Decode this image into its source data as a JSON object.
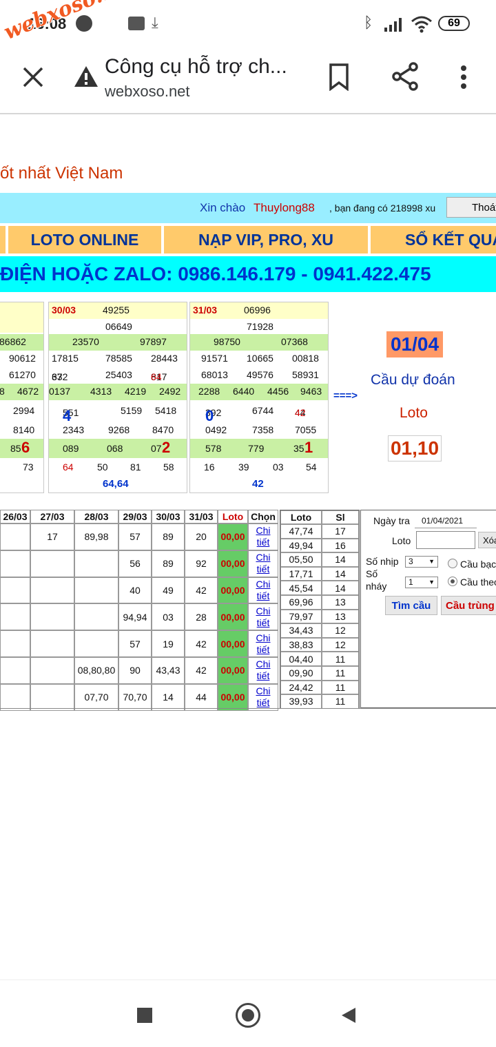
{
  "status": {
    "time": "16:08",
    "battery": "69"
  },
  "watermark": "webxoso.net",
  "browser": {
    "title": "Công cụ hỗ trợ ch...",
    "url": "webxoso.net"
  },
  "site": {
    "tagline": "ốt nhất Việt Nam",
    "greet_prefix": "Xin chào ",
    "username": "Thuylong88",
    "balance_text": ", bạn đang có 218998 xu",
    "logout_label": "Thoát",
    "menu": [
      "LOTO ONLINE",
      "NẠP VIP, PRO, XU",
      "SỔ KẾT QUẢ"
    ],
    "hotline": "ĐIỆN HOẶC ZALO: 0986.146.179 - 0941.422.475"
  },
  "results": {
    "b0": {
      "r1": "",
      "r2": "",
      "r3": "86862",
      "r4a": "90612",
      "r5": "61270",
      "r6a": "8",
      "r6b": "4672",
      "r7": "2994",
      "r8": "8140",
      "r9pre": "85",
      "r9big": "6",
      "r10": "73"
    },
    "b1": {
      "date": "30/03",
      "db": "49255",
      "g1": "06649",
      "g2a": "23570",
      "g2b": "97897",
      "g3": [
        "17815",
        "78585",
        "28443"
      ],
      "g3b": [
        "632",
        "37",
        "25403",
        "817",
        "64"
      ],
      "g4": [
        "0137",
        "4313",
        "4219",
        "2492"
      ],
      "g5a": "551",
      "g5abig": "4",
      "g5b": "5159",
      "g5c": "5418",
      "g5d": [
        "2343",
        "9268",
        "8470"
      ],
      "g6": [
        "089",
        "068"
      ],
      "g6cpre": "07",
      "g6cbig": "2",
      "g7": [
        "64",
        "50",
        "81",
        "58"
      ],
      "foot": "64,64"
    },
    "b2": {
      "date": "31/03",
      "db": "06996",
      "g1": "71928",
      "g2a": "98750",
      "g2b": "07368",
      "g3": [
        "91571",
        "10665",
        "00818"
      ],
      "g3b": [
        "68013",
        "49576",
        "58931"
      ],
      "g4": [
        "2288",
        "6440",
        "4456",
        "9463"
      ],
      "g5a": "392",
      "g5abig": "0",
      "g5b": "6744",
      "g5cpre": "44",
      "g5cred": "42",
      "g5d": [
        "0492",
        "7358",
        "7055"
      ],
      "g6": [
        "578",
        "779"
      ],
      "g6cpre": "35",
      "g6cbig": "1",
      "g7": [
        "16",
        "39",
        "03",
        "54"
      ],
      "foot": "42"
    },
    "arrow": "===>"
  },
  "prediction": {
    "date": "01/04",
    "label1": "Cầu dự đoán",
    "label2": "Loto",
    "value": "01,10"
  },
  "grid": {
    "headers": [
      "26/03",
      "27/03",
      "28/03",
      "29/03",
      "30/03",
      "31/03",
      "Loto",
      "Chọn"
    ],
    "link": [
      "Chi",
      "tiết"
    ],
    "rows": [
      [
        "",
        "17",
        "89,98",
        "57",
        "89",
        "20",
        "00,00"
      ],
      [
        "",
        "",
        "",
        "56",
        "89",
        "92",
        "00,00"
      ],
      [
        "",
        "",
        "",
        "40",
        "49",
        "42",
        "00,00"
      ],
      [
        "",
        "",
        "",
        "94,94",
        "03",
        "28",
        "00,00"
      ],
      [
        "",
        "",
        "",
        "57",
        "19",
        "42",
        "00,00"
      ],
      [
        "",
        "",
        "08,80,80",
        "90",
        "43,43",
        "42",
        "00,00"
      ],
      [
        "",
        "",
        "07,70",
        "70,70",
        "14",
        "44",
        "00,00"
      ]
    ]
  },
  "freq": {
    "headers": [
      "Loto",
      "Sl"
    ],
    "rows": [
      [
        "47,74",
        "17"
      ],
      [
        "49,94",
        "16"
      ],
      [
        "05,50",
        "14"
      ],
      [
        "17,71",
        "14"
      ],
      [
        "45,54",
        "14"
      ],
      [
        "69,96",
        "13"
      ],
      [
        "79,97",
        "13"
      ],
      [
        "34,43",
        "12"
      ],
      [
        "38,83",
        "12"
      ],
      [
        "04,40",
        "11"
      ],
      [
        "09,90",
        "11"
      ],
      [
        "24,42",
        "11"
      ],
      [
        "39,93",
        "11"
      ]
    ]
  },
  "form": {
    "date_label": "Ngày tra",
    "date_value": "01/04/2021",
    "loto_label": "Loto",
    "clear_label": "Xóa",
    "nhip_label": "Số nhịp",
    "nhip_value": "3",
    "nhay_label1": "Số",
    "nhay_label2": "nháy",
    "nhay_value": "1",
    "radio1": "Cầu bạc",
    "radio2": "Cầu theo",
    "find_btn": "Tìm cầu",
    "match_btn": "Cầu trùng"
  }
}
